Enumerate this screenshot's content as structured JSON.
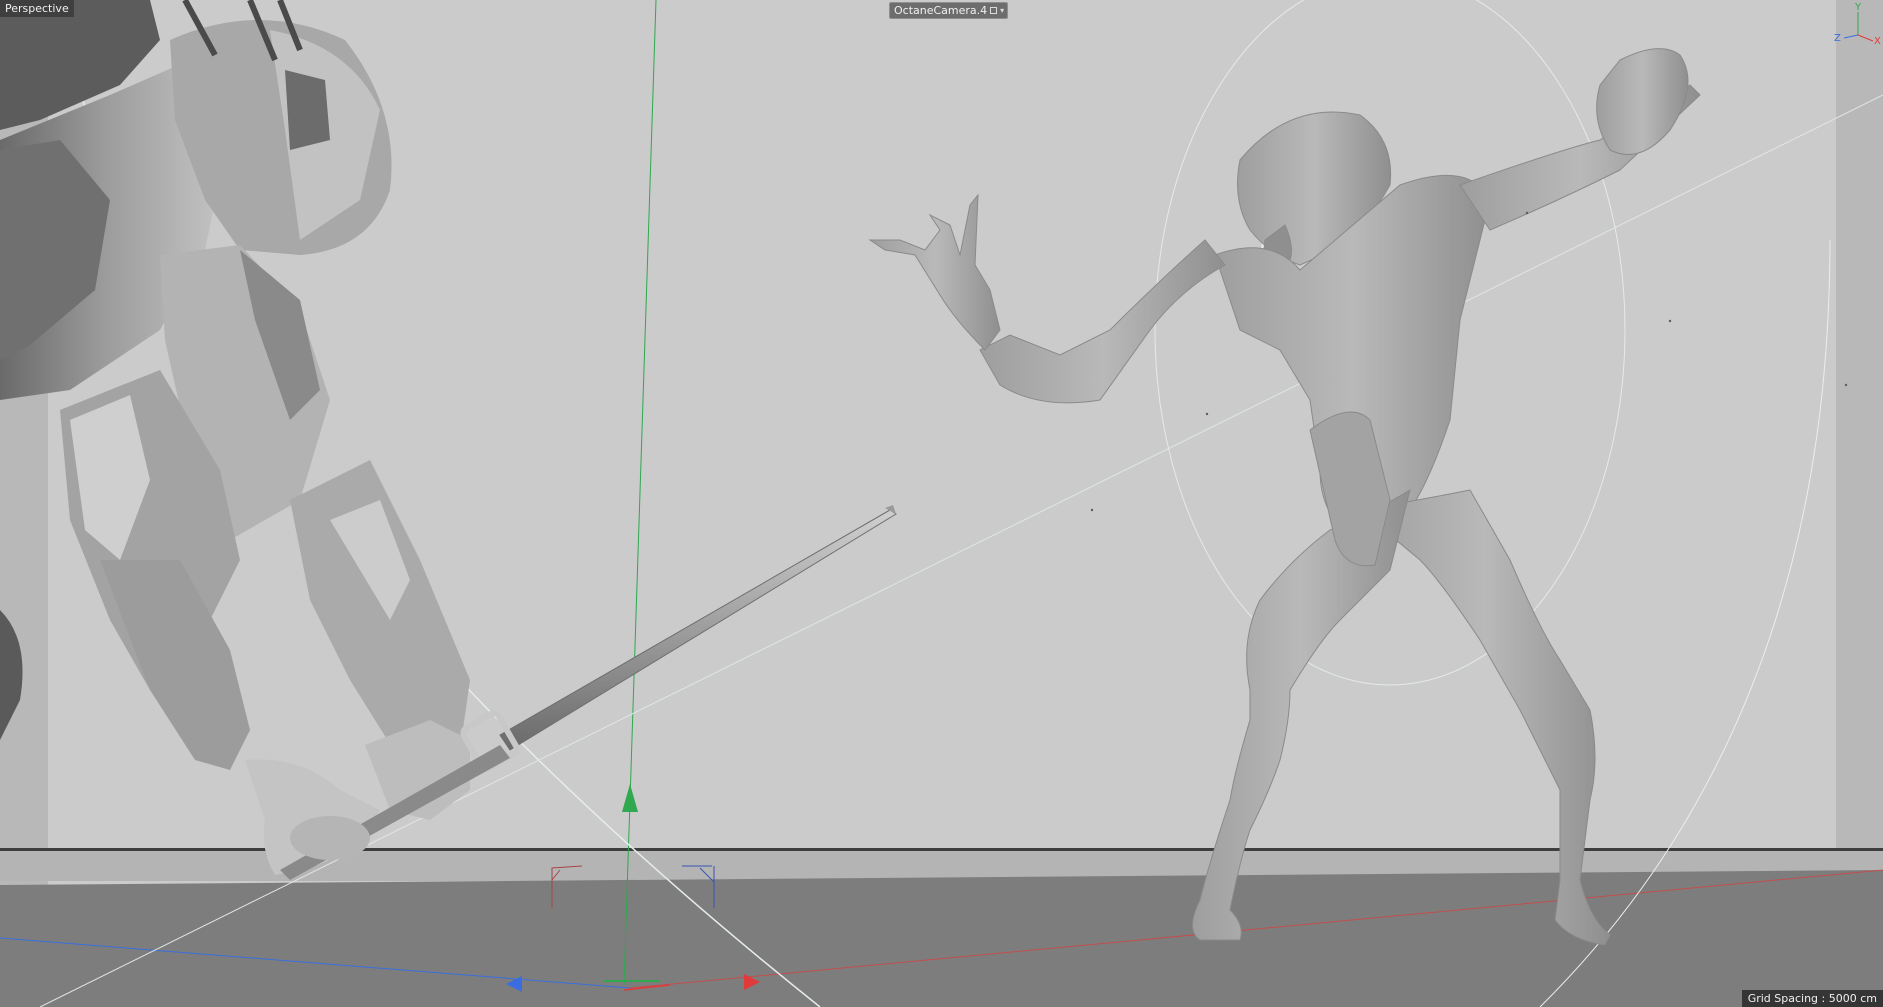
{
  "viewport": {
    "view_name": "Perspective",
    "camera_name": "OctaneCamera.4",
    "grid_spacing": "Grid Spacing : 5000 cm"
  },
  "axis_gizmo": {
    "y": "Y",
    "z": "Z",
    "x": "X"
  },
  "colors": {
    "background": "#cbcbcb",
    "floor": "#7d7d7d",
    "axis_x": "#e03a3a",
    "axis_y": "#2fa84f",
    "axis_z": "#3a6ee0"
  },
  "icons": {
    "camera_lock": "lock-icon",
    "camera_menu": "chevron-down-icon"
  }
}
